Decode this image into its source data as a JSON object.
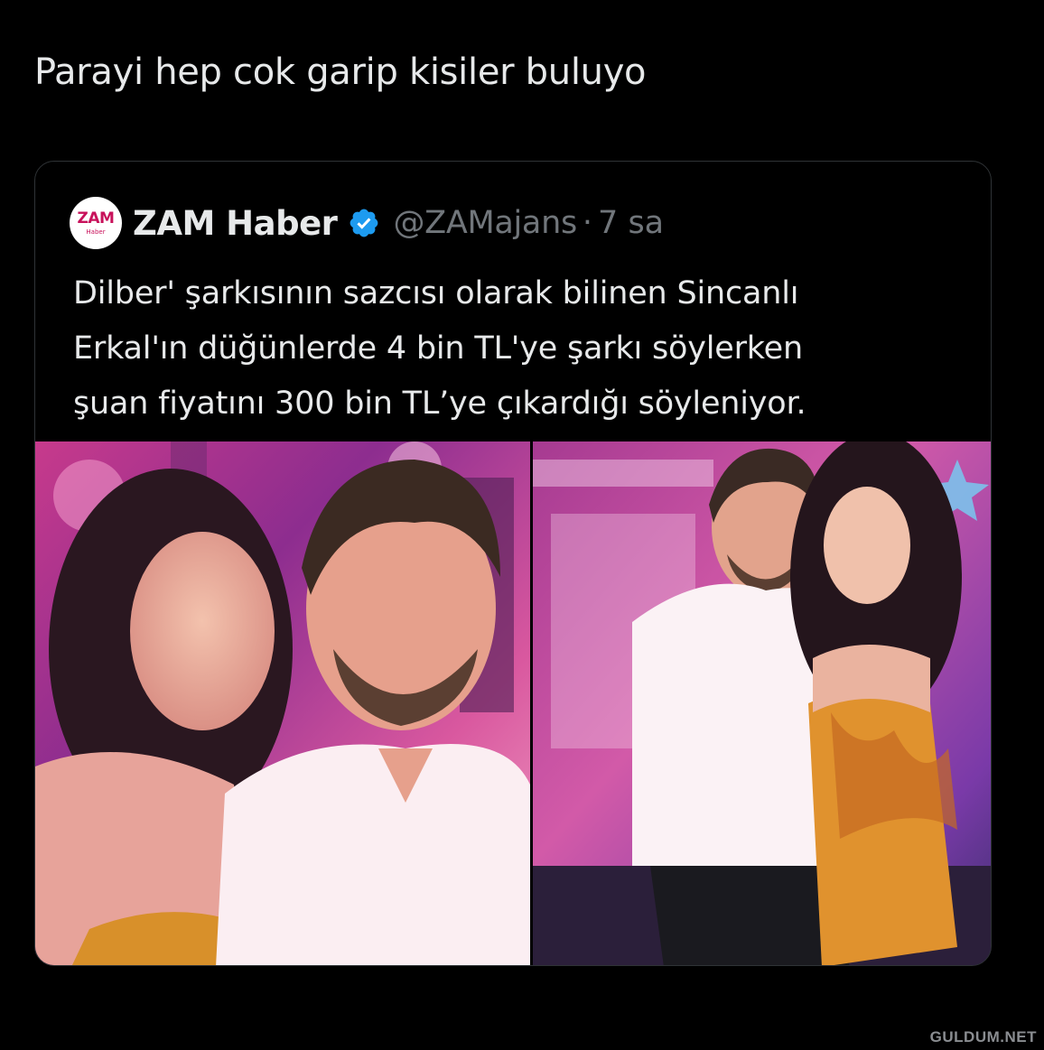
{
  "tweet": {
    "text": "Parayi hep cok garip kisiler buluyo"
  },
  "quote": {
    "avatar_word": "ZAM",
    "avatar_sub": "Haber",
    "display_name": "ZAM Haber",
    "handle": "@ZAMajans",
    "separator": "·",
    "time": "7 sa",
    "lines": [
      "Dilber' şarkısının sazcısı olarak bilinen Sincanlı",
      "Erkal'ın düğünlerde 4 bin TL'ye şarkı söylerken",
      "şuan fiyatını 300 bin TL’ye çıkardığı söyleniyor."
    ]
  },
  "watermark": "GULDUM.NET",
  "colors": {
    "background": "#000000",
    "text": "#e7e9ea",
    "muted": "#71767b",
    "border": "#2f3336",
    "verified": "#1d9bf0",
    "avatar_brand": "#c8125b"
  }
}
